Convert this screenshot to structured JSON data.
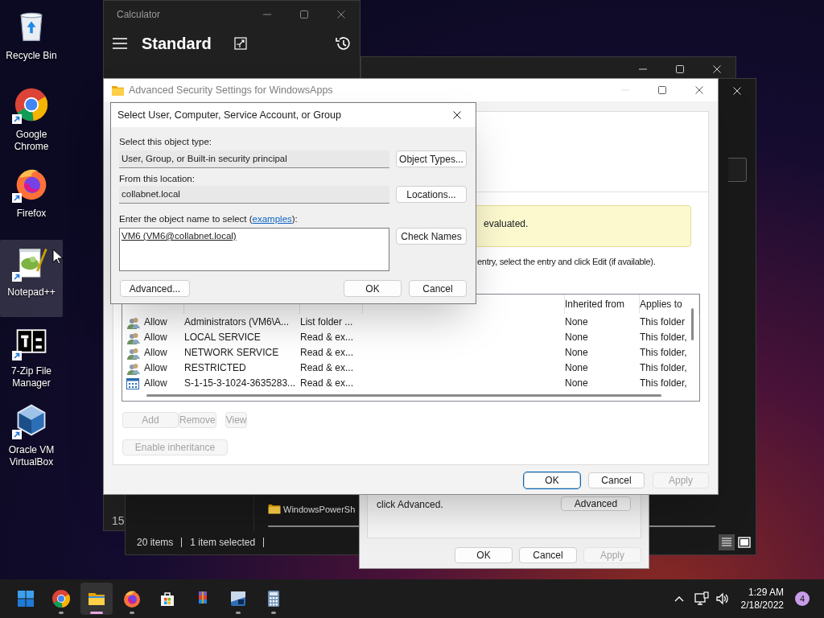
{
  "desktop_icons": [
    {
      "kind": "recycle",
      "label": "Recycle Bin",
      "shortcut": false,
      "selected": false
    },
    {
      "kind": "chrome",
      "label": "Google Chrome",
      "shortcut": true,
      "selected": false
    },
    {
      "kind": "firefox",
      "label": "Firefox",
      "shortcut": true,
      "selected": false
    },
    {
      "kind": "notepad",
      "label": "Notepad++",
      "shortcut": true,
      "selected": true
    },
    {
      "kind": "sevenzip",
      "label": "7-Zip File Manager",
      "shortcut": true,
      "selected": false
    },
    {
      "kind": "virtualbox",
      "label": "Oracle VM VirtualBox",
      "shortcut": true,
      "selected": false
    }
  ],
  "calculator": {
    "title": "Calculator",
    "mode": "Standard",
    "partial_text": "15"
  },
  "explorer": {
    "folder": "WindowsPowerSh",
    "status": [
      "20 items",
      "1 item selected"
    ]
  },
  "properties_dialog": {
    "text": "click Advanced.",
    "advanced_button": "Advanced",
    "buttons": [
      {
        "label": "OK",
        "disabled": false
      },
      {
        "label": "Cancel",
        "disabled": false
      },
      {
        "label": "Apply",
        "disabled": true
      }
    ]
  },
  "advanced_security": {
    "title": "Advanced Security Settings for WindowsApps",
    "notice": "evaluated.",
    "instruction": "entry, select the entry and click Edit (if available).",
    "table": {
      "columns": [
        "",
        "",
        "",
        "",
        "Inherited from",
        "Applies to"
      ],
      "rows": [
        {
          "kind": "group",
          "cells": [
            "Allow",
            "Administrators (VM6\\A...",
            "List folder ...",
            "",
            "None",
            "This folder"
          ]
        },
        {
          "kind": "group",
          "cells": [
            "Allow",
            "LOCAL SERVICE",
            "Read & ex...",
            "",
            "None",
            "This folder,"
          ]
        },
        {
          "kind": "group",
          "cells": [
            "Allow",
            "NETWORK SERVICE",
            "Read & ex...",
            "",
            "None",
            "This folder,"
          ]
        },
        {
          "kind": "group",
          "cells": [
            "Allow",
            "RESTRICTED",
            "Read & ex...",
            "",
            "None",
            "This folder,"
          ]
        },
        {
          "kind": "app",
          "cells": [
            "Allow",
            "S-1-15-3-1024-3635283...",
            "Read & ex...",
            "",
            "None",
            "This folder,"
          ]
        }
      ]
    },
    "action_buttons": [
      {
        "label": "Add",
        "disabled": true
      },
      {
        "label": "Remove",
        "disabled": true
      },
      {
        "label": "View",
        "disabled": true
      }
    ],
    "inheritance_button": {
      "label": "Enable inheritance",
      "disabled": true
    },
    "buttons": [
      {
        "label": "OK",
        "disabled": false,
        "default": true
      },
      {
        "label": "Cancel",
        "disabled": false,
        "default": false
      },
      {
        "label": "Apply",
        "disabled": true,
        "default": false
      }
    ]
  },
  "select_dialog": {
    "title": "Select User, Computer, Service Account, or Group",
    "object_type_label": "Select this object type:",
    "object_type": "User, Group, or Built-in security principal",
    "object_types_button": "Object Types...",
    "location_label": "From this location:",
    "location": "collabnet.local",
    "locations_button": "Locations...",
    "name_label_before": "Enter the object name to select (",
    "name_label_link": "examples",
    "name_label_after": "):",
    "name_value": "VM6 (VM6@collabnet.local)",
    "check_names_button": "Check Names",
    "buttons": [
      {
        "label": "Advanced...",
        "disabled": false
      },
      {
        "label": "OK",
        "disabled": false
      },
      {
        "label": "Cancel",
        "disabled": false
      }
    ]
  },
  "taskbar": {
    "apps": [
      {
        "kind": "start",
        "running": false,
        "active": false
      },
      {
        "kind": "chrome",
        "running": true,
        "active": false
      },
      {
        "kind": "explorer",
        "running": true,
        "active": true
      },
      {
        "kind": "firefox",
        "running": true,
        "active": false
      },
      {
        "kind": "store",
        "running": false,
        "active": false
      },
      {
        "kind": "winrar",
        "running": false,
        "active": false
      },
      {
        "kind": "tile",
        "running": true,
        "active": false
      },
      {
        "kind": "calculator",
        "running": true,
        "active": false
      }
    ],
    "time": "1:29 AM",
    "date": "2/18/2022",
    "notifications": "4"
  }
}
